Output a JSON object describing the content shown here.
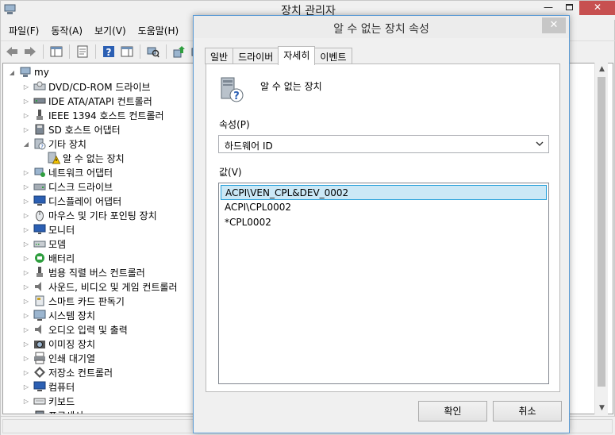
{
  "main_window": {
    "title": "장치 관리자",
    "controls": {
      "minimize": "—",
      "close": "✕"
    },
    "menu": [
      "파일(F)",
      "동작(A)",
      "보기(V)",
      "도움말(H)"
    ]
  },
  "tree": [
    {
      "label": "my",
      "toggle": "◢",
      "icon": "computer-icon",
      "level": 0
    },
    {
      "label": "DVD/CD-ROM 드라이브",
      "toggle": "▷",
      "icon": "dvd-drive-icon",
      "level": 1
    },
    {
      "label": "IDE ATA/ATAPI 컨트롤러",
      "toggle": "▷",
      "icon": "ide-controller-icon",
      "level": 1
    },
    {
      "label": "IEEE 1394 호스트 컨트롤러",
      "toggle": "▷",
      "icon": "ieee1394-icon",
      "level": 1
    },
    {
      "label": "SD 호스트 어댑터",
      "toggle": "▷",
      "icon": "sd-host-icon",
      "level": 1
    },
    {
      "label": "기타 장치",
      "toggle": "◢",
      "icon": "other-devices-icon",
      "level": 1
    },
    {
      "label": "알 수 없는 장치",
      "toggle": "",
      "icon": "unknown-device-warning-icon",
      "level": 2
    },
    {
      "label": "네트워크 어댑터",
      "toggle": "▷",
      "icon": "network-adapter-icon",
      "level": 1
    },
    {
      "label": "디스크 드라이브",
      "toggle": "▷",
      "icon": "disk-drive-icon",
      "level": 1
    },
    {
      "label": "디스플레이 어댑터",
      "toggle": "▷",
      "icon": "display-adapter-icon",
      "level": 1
    },
    {
      "label": "마우스 및 기타 포인팅 장치",
      "toggle": "▷",
      "icon": "mouse-icon",
      "level": 1
    },
    {
      "label": "모니터",
      "toggle": "▷",
      "icon": "monitor-icon",
      "level": 1
    },
    {
      "label": "모뎀",
      "toggle": "▷",
      "icon": "modem-icon",
      "level": 1
    },
    {
      "label": "배터리",
      "toggle": "▷",
      "icon": "battery-icon",
      "level": 1
    },
    {
      "label": "범용 직렬 버스 컨트롤러",
      "toggle": "▷",
      "icon": "usb-controller-icon",
      "level": 1
    },
    {
      "label": "사운드, 비디오 및 게임 컨트롤러",
      "toggle": "▷",
      "icon": "sound-icon",
      "level": 1
    },
    {
      "label": "스마트 카드 판독기",
      "toggle": "▷",
      "icon": "smart-card-icon",
      "level": 1
    },
    {
      "label": "시스템 장치",
      "toggle": "▷",
      "icon": "system-device-icon",
      "level": 1
    },
    {
      "label": "오디오 입력 및 출력",
      "toggle": "▷",
      "icon": "audio-io-icon",
      "level": 1
    },
    {
      "label": "이미징 장치",
      "toggle": "▷",
      "icon": "imaging-device-icon",
      "level": 1
    },
    {
      "label": "인쇄 대기열",
      "toggle": "▷",
      "icon": "print-queue-icon",
      "level": 1
    },
    {
      "label": "저장소 컨트롤러",
      "toggle": "▷",
      "icon": "storage-controller-icon",
      "level": 1
    },
    {
      "label": "컴퓨터",
      "toggle": "▷",
      "icon": "computer-node-icon",
      "level": 1
    },
    {
      "label": "키보드",
      "toggle": "▷",
      "icon": "keyboard-icon",
      "level": 1
    },
    {
      "label": "프로세서",
      "toggle": "▷",
      "icon": "processor-icon",
      "level": 1
    }
  ],
  "dialog": {
    "title": "알 수 없는 장치 속성",
    "close": "✕",
    "tabs": [
      "일반",
      "드라이버",
      "자세히",
      "이벤트"
    ],
    "active_tab": "자세히",
    "device_name": "알 수 없는 장치",
    "property_label": "속성(P)",
    "property_selected": "하드웨어 ID",
    "value_label": "값(V)",
    "values": [
      "ACPI\\VEN_CPL&DEV_0002",
      "ACPI\\CPL0002",
      "*CPL0002"
    ],
    "ok_label": "확인",
    "cancel_label": "취소"
  },
  "colors": {
    "selection_fill": "#cbe8f6",
    "selection_border": "#26a0da",
    "close_button": "#c75050",
    "warning": "#f5c400"
  }
}
